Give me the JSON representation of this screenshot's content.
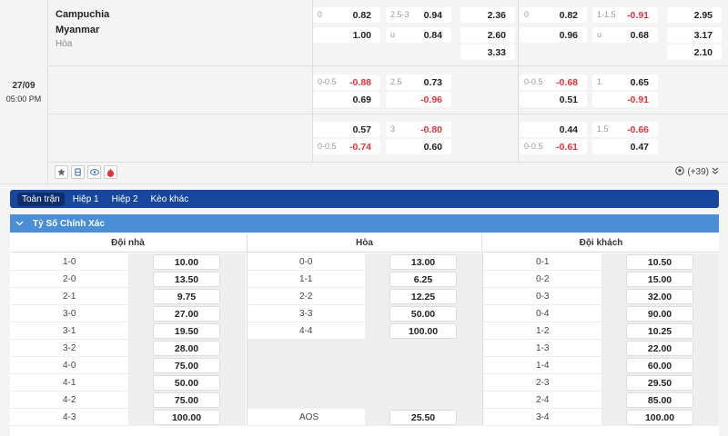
{
  "match": {
    "date": "27/09",
    "time": "05:00 PM",
    "home": "Campuchia",
    "away": "Myanmar",
    "draw": "Hòa",
    "more_count": "(+39)"
  },
  "ft": [
    [
      {
        "l": "0",
        "v": "0.82"
      },
      {
        "l": "2.5-3",
        "v": "0.94"
      },
      {
        "l": "",
        "v": "2.36"
      }
    ],
    [
      {
        "l": "",
        "v": "1.00"
      },
      {
        "l": "u",
        "v": "0.84"
      },
      {
        "l": "",
        "v": "2.60"
      }
    ],
    [
      null,
      null,
      {
        "l": "",
        "v": "3.33"
      }
    ],
    [
      {
        "l": "0-0.5",
        "v": "-0.88"
      },
      {
        "l": "2.5",
        "v": "0.73"
      },
      null
    ],
    [
      {
        "l": "",
        "v": "0.69"
      },
      {
        "l": "",
        "v": "-0.96"
      },
      null
    ],
    [
      {
        "l": "",
        "v": "0.57"
      },
      {
        "l": "3",
        "v": "-0.80"
      },
      null
    ],
    [
      {
        "l": "0-0.5",
        "v": "-0.74"
      },
      {
        "l": "",
        "v": "0.60"
      },
      null
    ]
  ],
  "h1": [
    [
      {
        "l": "0",
        "v": "0.82"
      },
      {
        "l": "1-1.5",
        "v": "-0.91"
      },
      {
        "l": "",
        "v": "2.95"
      }
    ],
    [
      {
        "l": "",
        "v": "0.96"
      },
      {
        "l": "u",
        "v": "0.68"
      },
      {
        "l": "",
        "v": "3.17"
      }
    ],
    [
      null,
      null,
      {
        "l": "",
        "v": "2.10"
      }
    ],
    [
      {
        "l": "0-0.5",
        "v": "-0.68"
      },
      {
        "l": "1",
        "v": "0.65"
      },
      null
    ],
    [
      {
        "l": "",
        "v": "0.51"
      },
      {
        "l": "",
        "v": "-0.91"
      },
      null
    ],
    [
      {
        "l": "",
        "v": "0.44"
      },
      {
        "l": "1.5",
        "v": "-0.66"
      },
      null
    ],
    [
      {
        "l": "0-0.5",
        "v": "-0.61"
      },
      {
        "l": "",
        "v": "0.47"
      },
      null
    ]
  ],
  "tabs": [
    "Toàn trận",
    "Hiệp 1",
    "Hiệp 2",
    "Kèo khác"
  ],
  "section_title": "Tỷ Số Chính Xác",
  "columns": [
    "Đội nhà",
    "Hòa",
    "Đội khách"
  ],
  "home_rows": [
    {
      "s": "1-0",
      "o": "10.00"
    },
    {
      "s": "2-0",
      "o": "13.50"
    },
    {
      "s": "2-1",
      "o": "9.75"
    },
    {
      "s": "3-0",
      "o": "27.00"
    },
    {
      "s": "3-1",
      "o": "19.50"
    },
    {
      "s": "3-2",
      "o": "28.00"
    },
    {
      "s": "4-0",
      "o": "75.00"
    },
    {
      "s": "4-1",
      "o": "50.00"
    },
    {
      "s": "4-2",
      "o": "75.00"
    },
    {
      "s": "4-3",
      "o": "100.00"
    }
  ],
  "draw_rows": [
    {
      "s": "0-0",
      "o": "13.00"
    },
    {
      "s": "1-1",
      "o": "6.25"
    },
    {
      "s": "2-2",
      "o": "12.25"
    },
    {
      "s": "3-3",
      "o": "50.00"
    },
    {
      "s": "4-4",
      "o": "100.00"
    }
  ],
  "aos": {
    "s": "AOS",
    "o": "25.50"
  },
  "away_rows": [
    {
      "s": "0-1",
      "o": "10.50"
    },
    {
      "s": "0-2",
      "o": "15.00"
    },
    {
      "s": "0-3",
      "o": "32.00"
    },
    {
      "s": "0-4",
      "o": "90.00"
    },
    {
      "s": "1-2",
      "o": "10.25"
    },
    {
      "s": "1-3",
      "o": "22.00"
    },
    {
      "s": "1-4",
      "o": "60.00"
    },
    {
      "s": "2-3",
      "o": "29.50"
    },
    {
      "s": "2-4",
      "o": "85.00"
    },
    {
      "s": "3-4",
      "o": "100.00"
    }
  ],
  "colors": {
    "tab_bar": "#17479d",
    "section_header": "#4a8fd6",
    "negative": "#e0333a"
  }
}
